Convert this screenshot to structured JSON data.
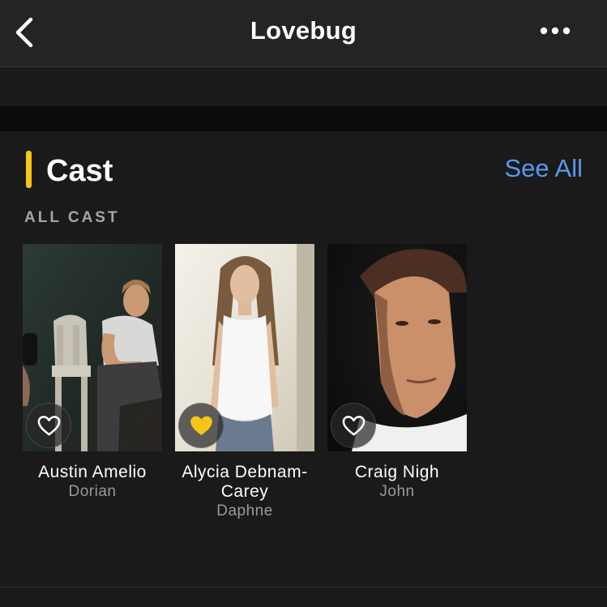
{
  "header": {
    "title": "Lovebug",
    "back_icon": "chevron-left-icon",
    "more_icon": "more-horizontal-icon"
  },
  "cast": {
    "title": "Cast",
    "see_all_label": "See All",
    "subheader": "ALL CAST",
    "members": [
      {
        "name": "Austin Amelio",
        "role": "Dorian",
        "favorited": false
      },
      {
        "name": "Alycia Debnam-Carey",
        "role": "Daphne",
        "favorited": true
      },
      {
        "name": "Craig Nigh",
        "role": "John",
        "favorited": false
      }
    ]
  },
  "colors": {
    "accent": "#f5c518",
    "link": "#5799ef",
    "background": "#1a1a1a",
    "navbar": "#242424"
  }
}
